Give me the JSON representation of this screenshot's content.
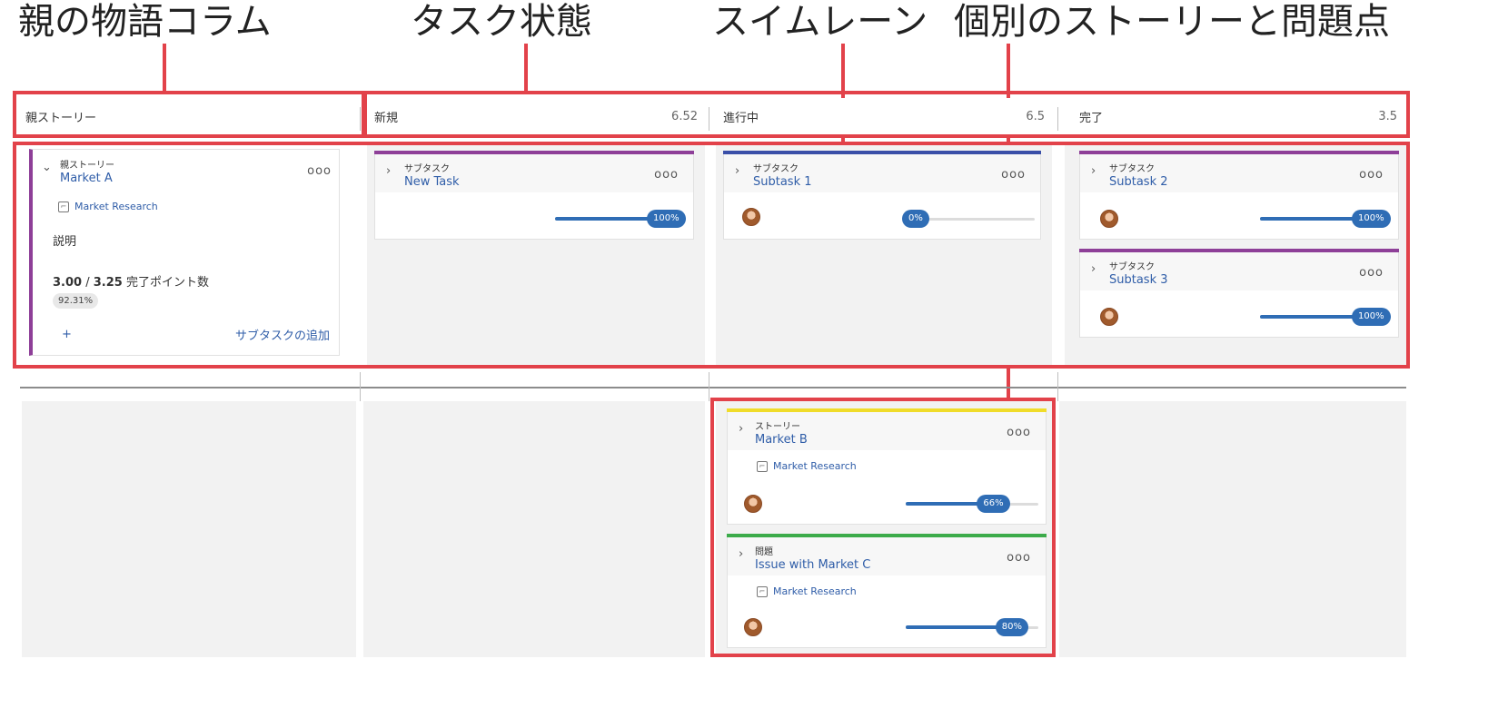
{
  "callouts": {
    "parent_column": "親の物語コラム",
    "task_state": "タスク状態",
    "swimlane": "スイムレーン",
    "stories_issues": "個別のストーリーと問題点"
  },
  "columns": {
    "parent": {
      "label": "親ストーリー"
    },
    "new": {
      "label": "新規",
      "points": "6.52"
    },
    "in_progress": {
      "label": "進行中",
      "points": "6.5"
    },
    "done": {
      "label": "完了",
      "points": "3.5"
    }
  },
  "parent_card": {
    "type": "親ストーリー",
    "title": "Market A",
    "tag": "Market Research",
    "description_label": "説明",
    "points_done": "3.00",
    "points_separator": "/",
    "points_total": "3.25",
    "points_label": "完了ポイント数",
    "percent_badge": "92.31%",
    "add_icon": "+",
    "add_subtask": "サブタスクの追加",
    "accent_color": "#8e3f98"
  },
  "cards": {
    "new_task": {
      "type": "サブタスク",
      "title": "New Task",
      "progress": 100,
      "progress_label": "100%",
      "accent_color": "#8e3f98"
    },
    "subtask1": {
      "type": "サブタスク",
      "title": "Subtask 1",
      "progress": 0,
      "progress_label": "0%",
      "accent_color": "#3a4fa8"
    },
    "subtask2": {
      "type": "サブタスク",
      "title": "Subtask 2",
      "progress": 100,
      "progress_label": "100%",
      "accent_color": "#8e3f98"
    },
    "subtask3": {
      "type": "サブタスク",
      "title": "Subtask 3",
      "progress": 100,
      "progress_label": "100%",
      "accent_color": "#8e3f98"
    },
    "market_b": {
      "type": "ストーリー",
      "title": "Market B",
      "tag": "Market Research",
      "progress": 66,
      "progress_label": "66%",
      "accent_color": "#f0dc2a"
    },
    "market_c": {
      "type": "問題",
      "title": "Issue with Market C",
      "tag": "Market Research",
      "progress": 80,
      "progress_label": "80%",
      "accent_color": "#3cab4a"
    }
  },
  "icons": {
    "chevron_right": "›",
    "chevron_down": "⌄",
    "more": "ooo",
    "tag": "⌐"
  },
  "colors": {
    "highlight_red": "#e2424a",
    "progress_blue": "#2f6db5",
    "link_blue": "#2f5da8"
  }
}
